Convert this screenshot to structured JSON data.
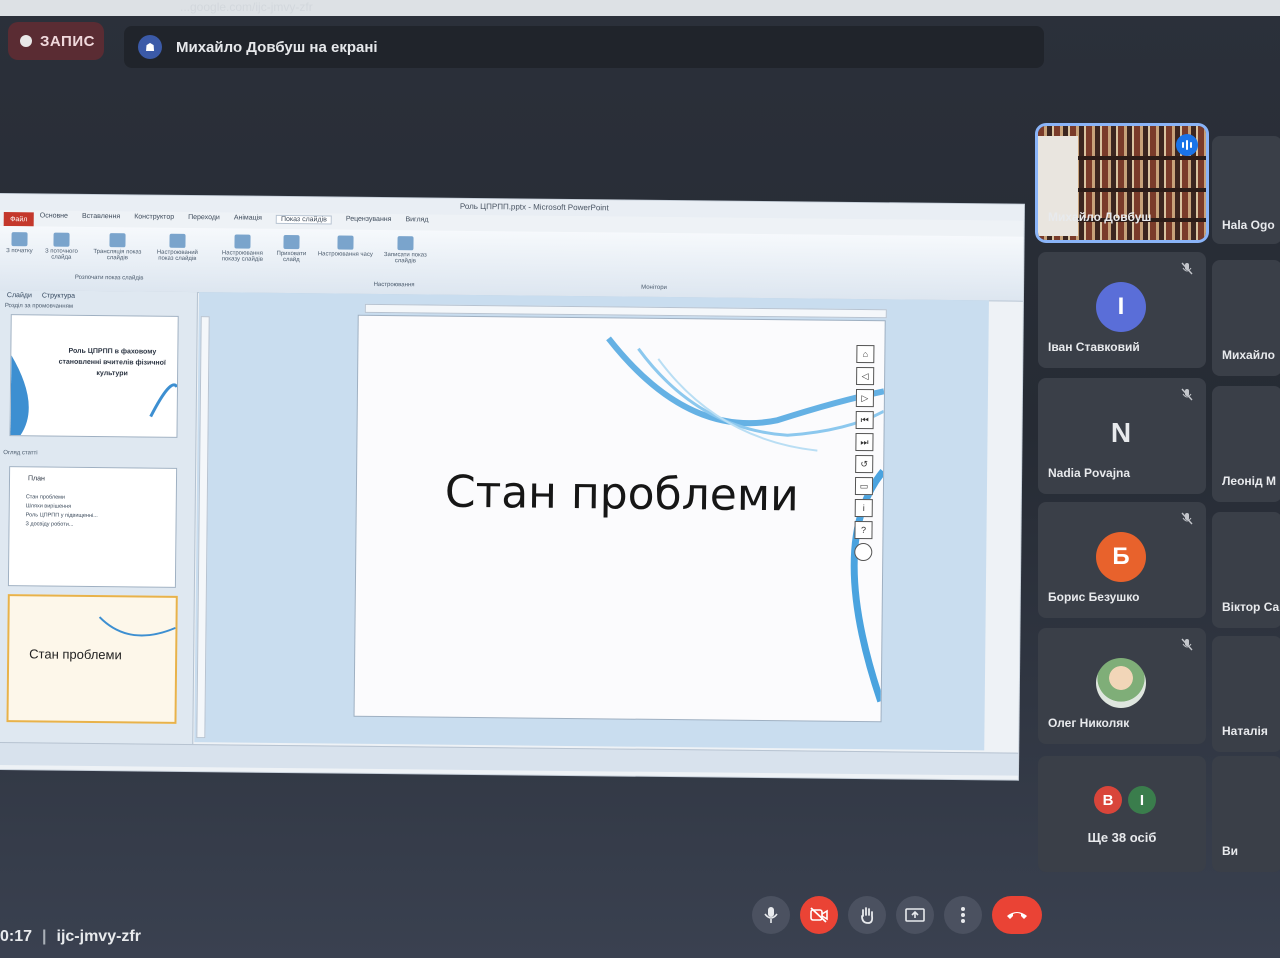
{
  "browser": {
    "url_fragment": "...google.com/ijc-jmvy-zfr"
  },
  "header": {
    "record_label": "ЗАПИС",
    "presenting_text": "Михайло Довбуш на екрані"
  },
  "powerpoint": {
    "window_title": "Роль ЦПРПП.pptx - Microsoft PowerPoint",
    "file_tab": "Файл",
    "tabs": [
      "Основне",
      "Вставлення",
      "Конструктор",
      "Переходи",
      "Анімація",
      "Показ слайдів",
      "Рецензування",
      "Вигляд"
    ],
    "active_tab": "Показ слайдів",
    "ribbon": {
      "from_start": "З початку",
      "from_current": "З поточного слайда",
      "broadcast": "Трансляція показ слайдів",
      "custom": "Настроюваний показ слайдів",
      "group_start": "Розпочати показ слайдів",
      "setup": "Настроювання показу слайдів",
      "hide": "Приховати слайд",
      "timings": "Настроювання часу",
      "record": "Записати показ слайдів",
      "group_setup": "Настроювання",
      "monitors": "Монітори"
    },
    "sidebar": {
      "tab_slides": "Слайди",
      "tab_outline": "Структура",
      "section1": "Розділ за промовчанням",
      "section2": "Огляд статті",
      "slide1_title": "Роль ЦПРПП в фаховому становленні вчителів фізичної культури",
      "slide2_title": "План",
      "slide2_items": [
        "Стан проблеми",
        "Шляхи вирішення",
        "Роль ЦПРПП у підвищенні...",
        "З досвіду роботи..."
      ],
      "slide3_title": "Стан проблеми"
    },
    "slide": {
      "title": "Стан проблеми"
    }
  },
  "participants": [
    {
      "name": "Михайло Довбуш",
      "type": "video",
      "speaking": true
    },
    {
      "name": "Hala Ogo",
      "type": "partial"
    },
    {
      "name": "Іван Ставковий",
      "initial": "І",
      "color": "#5a6ed8",
      "muted": true
    },
    {
      "name": "Михайло",
      "type": "partial"
    },
    {
      "name": "Nadia Povajna",
      "initial": "N",
      "color": "#3a3f48",
      "muted": true
    },
    {
      "name": "Леонід М",
      "type": "partial"
    },
    {
      "name": "Борис Безушко",
      "initial": "Б",
      "color": "#e8622c",
      "muted": true
    },
    {
      "name": "Віктор Са",
      "type": "partial"
    },
    {
      "name": "Олег Николяк",
      "type": "photo",
      "muted": true
    },
    {
      "name": "Наталія",
      "type": "partial"
    },
    {
      "name": "Ще 38 осіб",
      "type": "more"
    },
    {
      "name": "Ви",
      "type": "partial"
    }
  ],
  "more_avatars": [
    {
      "initial": "В",
      "color": "#d9453a"
    },
    {
      "initial": "І",
      "color": "#3a7d4c"
    }
  ],
  "footer": {
    "time": "0:17",
    "meeting_code": "ijc-jmvy-zfr"
  }
}
